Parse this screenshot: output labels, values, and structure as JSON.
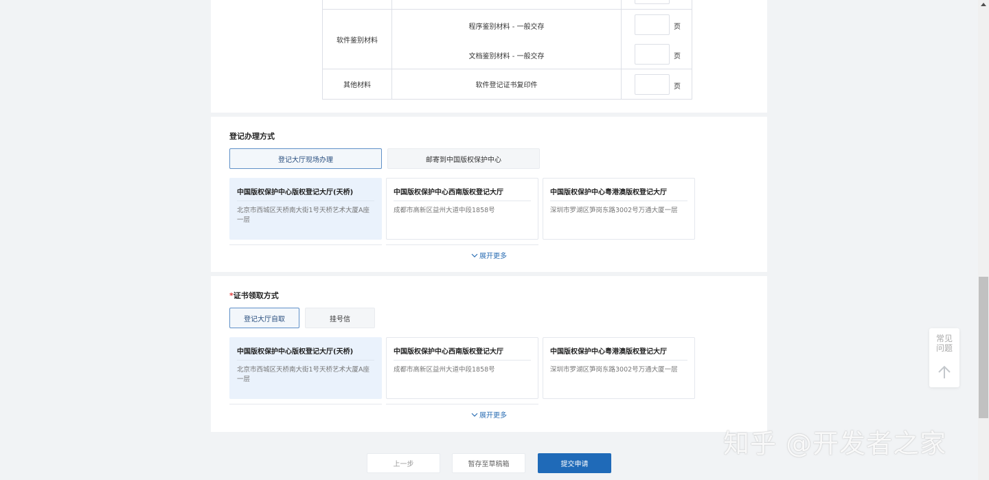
{
  "materials": {
    "rows": [
      {
        "category": "软件鉴别材料",
        "items": [
          {
            "name": "程序鉴别材料 - 一般交存",
            "unit": "页",
            "value": ""
          },
          {
            "name": "文档鉴别材料 - 一般交存",
            "unit": "页",
            "value": ""
          }
        ]
      },
      {
        "category": "其他材料",
        "items": [
          {
            "name": "软件登记证书复印件",
            "unit": "页",
            "value": ""
          }
        ]
      }
    ]
  },
  "registration": {
    "title": "登记办理方式",
    "tabs": [
      "登记大厅现场办理",
      "邮寄到中国版权保护中心"
    ],
    "active_tab": 0,
    "halls": [
      {
        "name": "中国版权保护中心版权登记大厅(天桥)",
        "address": "北京市西城区天桥南大街1号天桥艺术大厦A座一层"
      },
      {
        "name": "中国版权保护中心西南版权登记大厅",
        "address": "成都市高新区益州大道中段1858号"
      },
      {
        "name": "中国版权保护中心粤港澳版权登记大厅",
        "address": "深圳市罗湖区笋岗东路3002号万通大厦一层"
      }
    ],
    "more_label": "展开更多"
  },
  "certificate": {
    "required_mark": "*",
    "title": "证书领取方式",
    "tabs": [
      "登记大厅自取",
      "挂号信"
    ],
    "active_tab": 0,
    "halls": [
      {
        "name": "中国版权保护中心版权登记大厅(天桥)",
        "address": "北京市西城区天桥南大街1号天桥艺术大厦A座一层"
      },
      {
        "name": "中国版权保护中心西南版权登记大厅",
        "address": "成都市高新区益州大道中段1858号"
      },
      {
        "name": "中国版权保护中心粤港澳版权登记大厅",
        "address": "深圳市罗湖区笋岗东路3002号万通大厦一层"
      }
    ],
    "more_label": "展开更多"
  },
  "footer": {
    "prev_label": "上一步",
    "draft_label": "暂存至草稿箱",
    "submit_label": "提交申请"
  },
  "faq": {
    "label": "常见问题"
  },
  "watermark": "知乎 @开发者之家",
  "colors": {
    "primary": "#1f6ab8",
    "selected_card": "#eaf2fc",
    "link": "#2a6db3"
  }
}
